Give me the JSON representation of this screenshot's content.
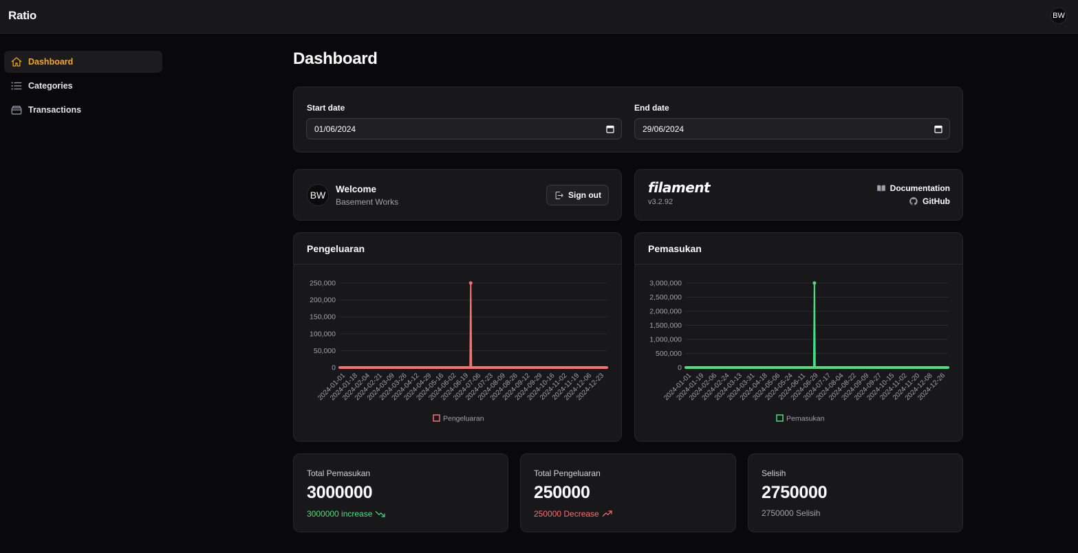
{
  "app": {
    "brand": "Ratio",
    "user_initials": "BW"
  },
  "sidebar": {
    "items": [
      {
        "label": "Dashboard",
        "icon": "home-icon",
        "active": true
      },
      {
        "label": "Categories",
        "icon": "list-icon",
        "active": false
      },
      {
        "label": "Transactions",
        "icon": "wallet-icon",
        "active": false
      }
    ]
  },
  "page": {
    "title": "Dashboard"
  },
  "filters": {
    "start_label": "Start date",
    "start_value": "01/06/2024",
    "end_label": "End date",
    "end_value": "29/06/2024"
  },
  "welcome": {
    "initials": "BW",
    "title": "Welcome",
    "subtitle": "Basement Works",
    "signout_label": "Sign out"
  },
  "filament": {
    "logo": "filament",
    "version": "v3.2.92",
    "docs_label": "Documentation",
    "github_label": "GitHub"
  },
  "charts": {
    "expense_title": "Pengeluaran",
    "income_title": "Pemasukan"
  },
  "chart_data": [
    {
      "type": "line",
      "title": "Pengeluaran",
      "color": "#f87171",
      "legend": "Pengeluaran",
      "ylim": [
        0,
        250000
      ],
      "yticks": [
        0,
        50000,
        100000,
        150000,
        200000,
        250000
      ],
      "ytick_labels": [
        "0",
        "50,000",
        "100,000",
        "150,000",
        "200,000",
        "250,000"
      ],
      "xtick_labels": [
        "2024-01-01",
        "2024-01-18",
        "2024-02-04",
        "2024-02-21",
        "2024-03-09",
        "2024-03-26",
        "2024-04-12",
        "2024-04-29",
        "2024-05-16",
        "2024-06-02",
        "2024-06-19",
        "2024-07-06",
        "2024-07-23",
        "2024-08-09",
        "2024-08-26",
        "2024-09-12",
        "2024-09-29",
        "2024-10-16",
        "2024-11-02",
        "2024-11-19",
        "2024-12-06",
        "2024-12-23"
      ],
      "x_start": "2024-01-01",
      "x_end": "2024-12-31",
      "peak_date": "2024-06-28",
      "peak_value": 250000
    },
    {
      "type": "line",
      "title": "Pemasukan",
      "color": "#4ade80",
      "legend": "Pemasukan",
      "ylim": [
        0,
        3000000
      ],
      "yticks": [
        0,
        500000,
        1000000,
        1500000,
        2000000,
        2500000,
        3000000
      ],
      "ytick_labels": [
        "0",
        "500,000",
        "1,000,000",
        "1,500,000",
        "2,000,000",
        "2,500,000",
        "3,000,000"
      ],
      "xtick_labels": [
        "2024-01-01",
        "2024-01-19",
        "2024-02-06",
        "2024-02-24",
        "2024-03-13",
        "2024-03-31",
        "2024-04-18",
        "2024-05-06",
        "2024-05-24",
        "2024-06-11",
        "2024-06-29",
        "2024-07-17",
        "2024-08-04",
        "2024-08-22",
        "2024-09-09",
        "2024-09-27",
        "2024-10-15",
        "2024-11-02",
        "2024-11-20",
        "2024-12-08",
        "2024-12-26"
      ],
      "x_start": "2024-01-01",
      "x_end": "2024-12-31",
      "peak_date": "2024-06-28",
      "peak_value": 3000000
    }
  ],
  "stats": [
    {
      "label": "Total Pemasukan",
      "value": "3000000",
      "desc": "3000000 increase",
      "color": "#4ade80",
      "icon": "trending-down-icon"
    },
    {
      "label": "Total Pengeluaran",
      "value": "250000",
      "desc": "250000 Decrease",
      "color": "#f87171",
      "icon": "trending-up-icon"
    },
    {
      "label": "Selisih",
      "value": "2750000",
      "desc": "2750000 Selisih",
      "color": "#a1a1aa",
      "icon": ""
    }
  ]
}
